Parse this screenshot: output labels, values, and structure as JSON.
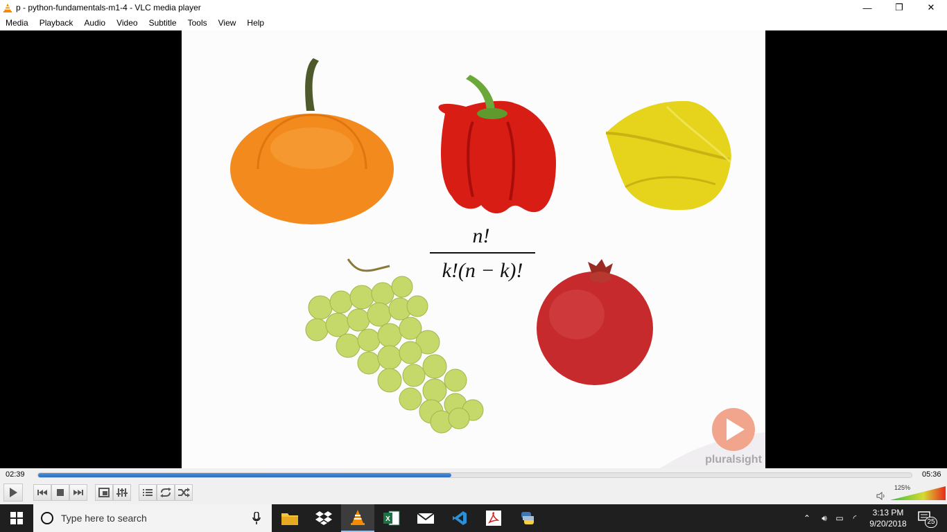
{
  "window": {
    "title": "p - python-fundamentals-m1-4 - VLC media player",
    "controls": {
      "minimize": "—",
      "restore": "❐",
      "close": "✕"
    }
  },
  "menu": [
    "Media",
    "Playback",
    "Audio",
    "Video",
    "Subtitle",
    "Tools",
    "View",
    "Help"
  ],
  "video": {
    "formula_numerator": "n!",
    "formula_denominator": "k!(n − k)!",
    "watermark": "pluralsight"
  },
  "playback": {
    "elapsed": "02:39",
    "total": "05:36",
    "progress": 0.473,
    "volume_label": "125%",
    "volume_level": 1.25
  },
  "taskbar": {
    "search_placeholder": "Type here to search",
    "time": "3:13 PM",
    "date": "9/20/2018",
    "notification_count": "25"
  }
}
